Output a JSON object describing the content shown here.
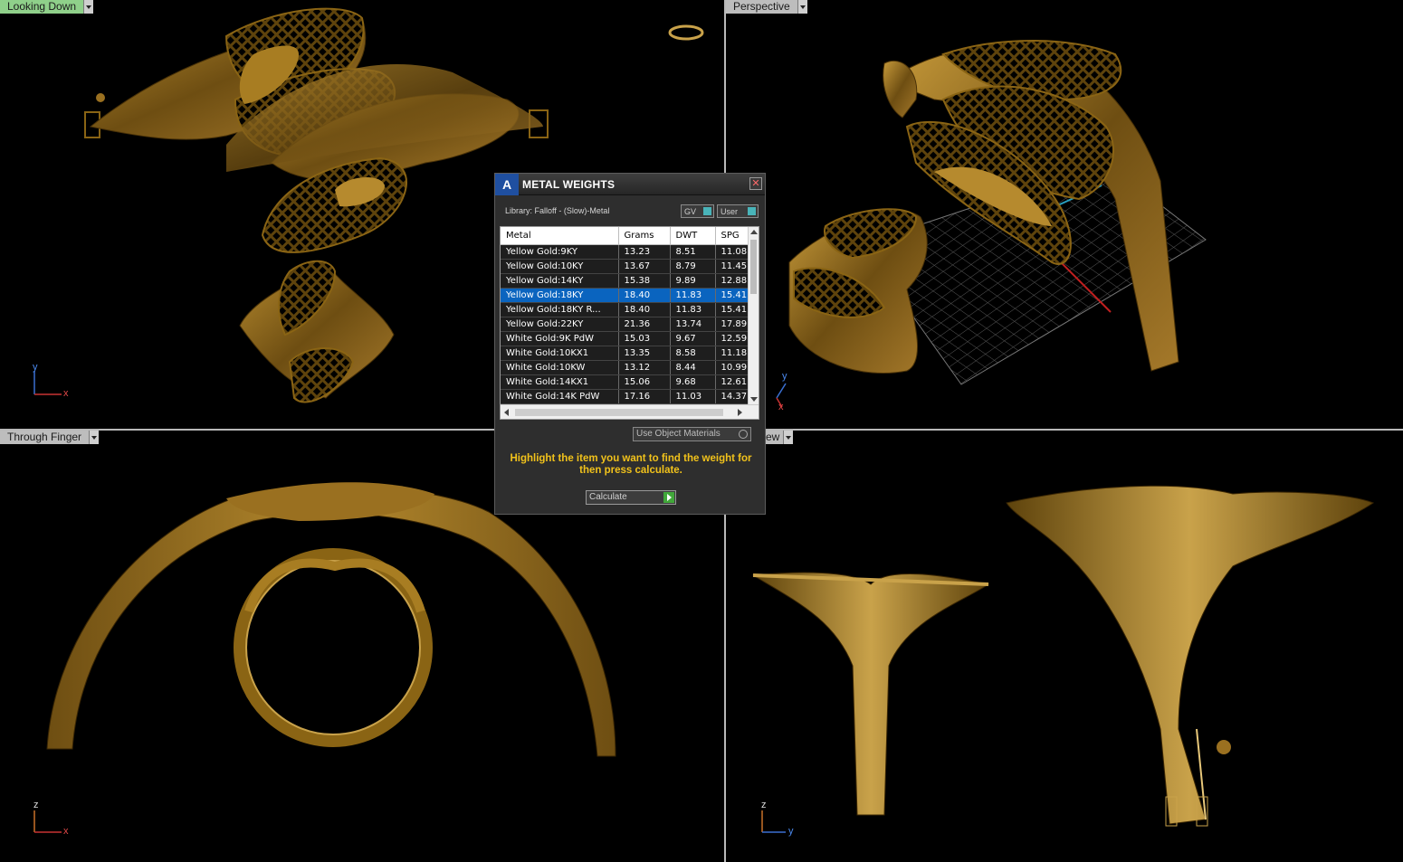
{
  "viewports": {
    "top_left": {
      "label": "Looking Down",
      "axes": {
        "v": "y",
        "h": "x"
      }
    },
    "top_right": {
      "label": "Perspective",
      "axes": {
        "v": "y",
        "h": "x"
      }
    },
    "bottom_left": {
      "label": "Through Finger",
      "axes": {
        "v": "z",
        "h": "x"
      }
    },
    "bottom_right": {
      "label": "ew",
      "axes": {
        "v": "z",
        "h": "y"
      }
    }
  },
  "dialog": {
    "title": "METAL WEIGHTS",
    "logo_glyph": "A",
    "close_glyph": "✕",
    "library_label": "Library: Falloff - (Slow)-Metal",
    "gv_label": "GV",
    "user_label": "User",
    "columns": [
      "Metal",
      "Grams",
      "DWT",
      "SPG"
    ],
    "rows": [
      {
        "metal": "Yellow Gold:9KY",
        "grams": "13.23",
        "dwt": "8.51",
        "spg": "11.08"
      },
      {
        "metal": "Yellow Gold:10KY",
        "grams": "13.67",
        "dwt": "8.79",
        "spg": "11.45"
      },
      {
        "metal": "Yellow Gold:14KY",
        "grams": "15.38",
        "dwt": "9.89",
        "spg": "12.88"
      },
      {
        "metal": "Yellow Gold:18KY",
        "grams": "18.40",
        "dwt": "11.83",
        "spg": "15.41",
        "selected": true
      },
      {
        "metal": "Yellow Gold:18KY R...",
        "grams": "18.40",
        "dwt": "11.83",
        "spg": "15.41"
      },
      {
        "metal": "Yellow Gold:22KY",
        "grams": "21.36",
        "dwt": "13.74",
        "spg": "17.89"
      },
      {
        "metal": "White Gold:9K PdW",
        "grams": "15.03",
        "dwt": "9.67",
        "spg": "12.59"
      },
      {
        "metal": "White Gold:10KX1",
        "grams": "13.35",
        "dwt": "8.58",
        "spg": "11.18"
      },
      {
        "metal": "White Gold:10KW",
        "grams": "13.12",
        "dwt": "8.44",
        "spg": "10.99"
      },
      {
        "metal": "White Gold:14KX1",
        "grams": "15.06",
        "dwt": "9.68",
        "spg": "12.61"
      },
      {
        "metal": "White Gold:14K PdW",
        "grams": "17.16",
        "dwt": "11.03",
        "spg": "14.37"
      }
    ],
    "use_object_materials": "Use Object Materials",
    "hint": "Highlight the item you want to find the weight for then press calculate.",
    "calculate_label": "Calculate"
  },
  "colors": {
    "gold": "#8a6414",
    "gold_light": "#c9a24a",
    "selection": "#0a64bf",
    "hint_text": "#f1c21b",
    "active_viewport_label": "#8fd08a"
  }
}
